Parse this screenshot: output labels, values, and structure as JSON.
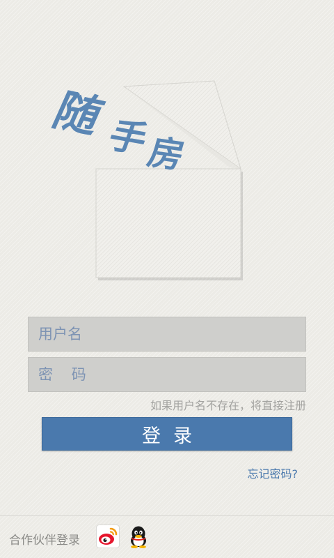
{
  "brand": {
    "chars": [
      "随",
      "手",
      "房"
    ],
    "color": "#5a86b4"
  },
  "form": {
    "username_placeholder": "用户名",
    "password_placeholder": "密    码",
    "register_hint": "如果用户名不存在，将直接注册",
    "login_label": "登录",
    "forgot_label": "忘记密码?"
  },
  "partners": {
    "label": "合作伙伴登录",
    "icons": [
      "weibo-icon",
      "qq-icon"
    ]
  },
  "colors": {
    "accent": "#4a79ad",
    "background": "#ecebe6",
    "input_bg": "#cfcfcc"
  }
}
